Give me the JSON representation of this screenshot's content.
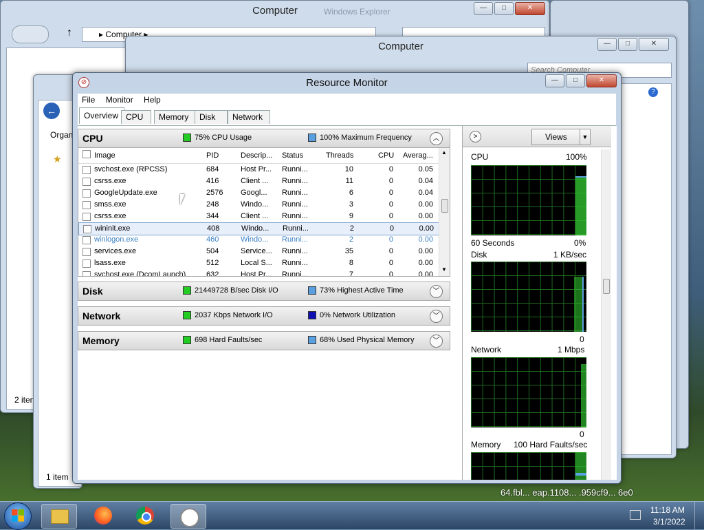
{
  "background_windows": {
    "explorer_back_title": "Computer",
    "explorer_back_address": "Computer",
    "explorer_back_status": "2 item",
    "explorer_back_nav": "Windows Explorer",
    "explorer_mid_title": "Computer",
    "explorer_mid_search_placeholder": "Search Computer",
    "explorer_front_organize": "Organ",
    "explorer_front_status": "1 item"
  },
  "resource_monitor": {
    "title": "Resource Monitor",
    "menu": [
      "File",
      "Monitor",
      "Help"
    ],
    "tabs": [
      "Overview",
      "CPU",
      "Memory",
      "Disk",
      "Network"
    ],
    "active_tab": "Overview",
    "cpu_section": {
      "name": "CPU",
      "stat1": "75% CPU Usage",
      "stat1_color": "#22cc22",
      "stat2": "100% Maximum Frequency",
      "stat2_color": "#5aa0e0",
      "columns": [
        "Image",
        "PID",
        "Descrip...",
        "Status",
        "Threads",
        "CPU",
        "Averag..."
      ],
      "rows": [
        {
          "image": "svchost.exe (RPCSS)",
          "pid": "684",
          "desc": "Host Pr...",
          "status": "Runni...",
          "threads": "10",
          "cpu": "0",
          "avg": "0.05"
        },
        {
          "image": "csrss.exe",
          "pid": "416",
          "desc": "Client ...",
          "status": "Runni...",
          "threads": "11",
          "cpu": "0",
          "avg": "0.04"
        },
        {
          "image": "GoogleUpdate.exe",
          "pid": "2576",
          "desc": "Googl...",
          "status": "Runni...",
          "threads": "6",
          "cpu": "0",
          "avg": "0.04"
        },
        {
          "image": "smss.exe",
          "pid": "248",
          "desc": "Windo...",
          "status": "Runni...",
          "threads": "3",
          "cpu": "0",
          "avg": "0.00"
        },
        {
          "image": "csrss.exe",
          "pid": "344",
          "desc": "Client ...",
          "status": "Runni...",
          "threads": "9",
          "cpu": "0",
          "avg": "0.00"
        },
        {
          "image": "wininit.exe",
          "pid": "408",
          "desc": "Windo...",
          "status": "Runni...",
          "threads": "2",
          "cpu": "0",
          "avg": "0.00"
        },
        {
          "image": "winlogon.exe",
          "pid": "460",
          "desc": "Windo...",
          "status": "Runni...",
          "threads": "2",
          "cpu": "0",
          "avg": "0.00"
        },
        {
          "image": "services.exe",
          "pid": "504",
          "desc": "Service...",
          "status": "Runni...",
          "threads": "35",
          "cpu": "0",
          "avg": "0.00"
        },
        {
          "image": "lsass.exe",
          "pid": "512",
          "desc": "Local S...",
          "status": "Runni...",
          "threads": "8",
          "cpu": "0",
          "avg": "0.00"
        },
        {
          "image": "svchost.exe (DcomLaunch)",
          "pid": "632",
          "desc": "Host Pr...",
          "status": "Runni...",
          "threads": "7",
          "cpu": "0",
          "avg": "0.00"
        }
      ],
      "selected_row_index": 5,
      "highlighted_row_index": 6
    },
    "disk_section": {
      "name": "Disk",
      "stat1": "21449728 B/sec Disk I/O",
      "stat1_color": "#22cc22",
      "stat2": "73% Highest Active Time",
      "stat2_color": "#5aa0e0"
    },
    "network_section": {
      "name": "Network",
      "stat1": "2037 Kbps Network I/O",
      "stat1_color": "#22cc22",
      "stat2": "0% Network Utilization",
      "stat2_color": "#1010b0"
    },
    "memory_section": {
      "name": "Memory",
      "stat1": "698 Hard Faults/sec",
      "stat1_color": "#22cc22",
      "stat2": "68% Used Physical Memory",
      "stat2_color": "#5aa0e0"
    },
    "right_pane": {
      "views_label": "Views",
      "graphs": [
        {
          "name": "CPU",
          "top_value": "100%",
          "bottom_left": "60 Seconds",
          "bottom_right": "0%"
        },
        {
          "name": "Disk",
          "top_value": "1 KB/sec",
          "bottom_left": "",
          "bottom_right": "0"
        },
        {
          "name": "Network",
          "top_value": "1 Mbps",
          "bottom_left": "",
          "bottom_right": "0"
        },
        {
          "name": "Memory",
          "top_value": "100 Hard Faults/sec",
          "bottom_left": "",
          "bottom_right": ""
        }
      ]
    }
  },
  "taskbar": {
    "time": "11:18 AM",
    "date": "3/1/2022",
    "pinned": [
      "windows-explorer-icon",
      "firefox-icon",
      "chrome-icon",
      "resource-monitor-icon"
    ]
  }
}
